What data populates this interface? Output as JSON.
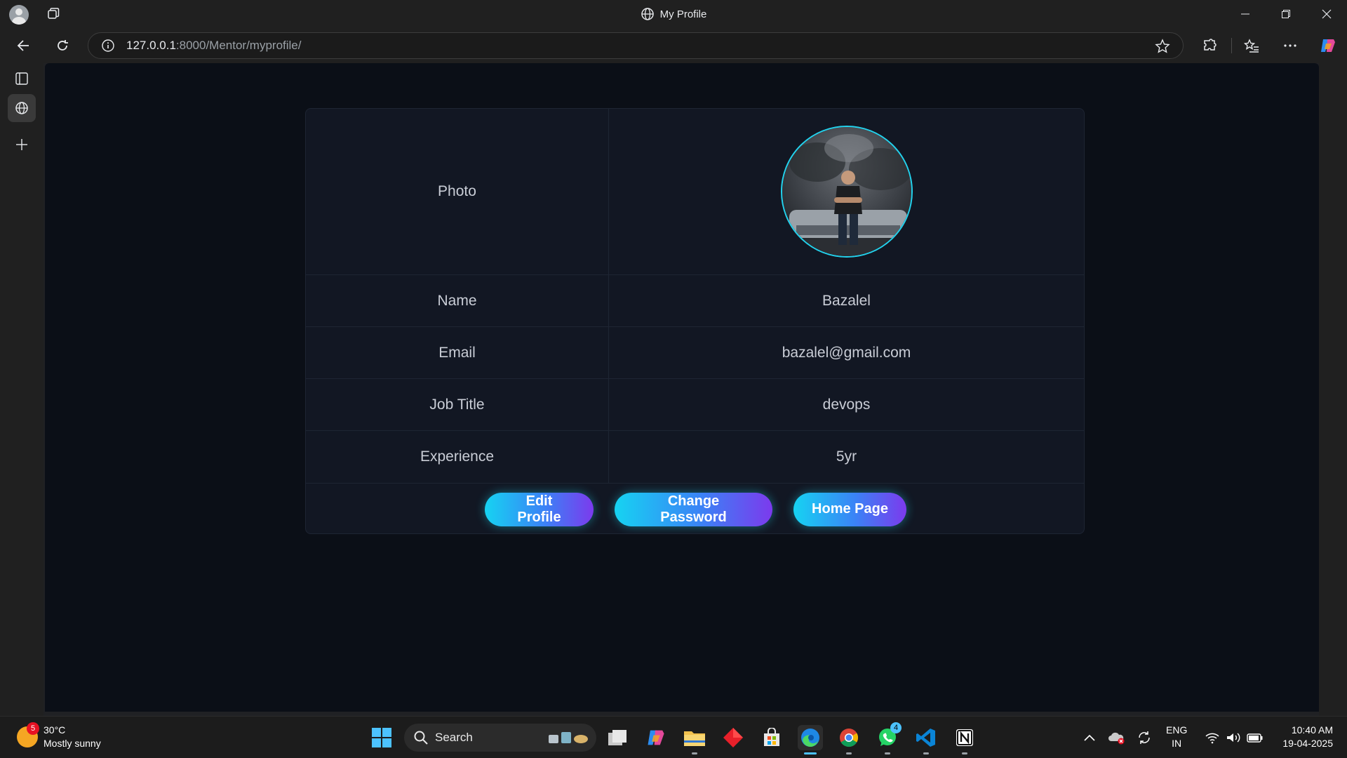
{
  "window": {
    "title": "My Profile"
  },
  "addressbar": {
    "url_host": "127.0.0.1",
    "url_rest": ":8000/Mentor/myprofile/"
  },
  "profile": {
    "rows": [
      {
        "label": "Photo",
        "value": ""
      },
      {
        "label": "Name",
        "value": "Bazalel"
      },
      {
        "label": "Email",
        "value": "bazalel@gmail.com"
      },
      {
        "label": "Job Title",
        "value": "devops"
      },
      {
        "label": "Experience",
        "value": "5yr"
      }
    ],
    "buttons": {
      "edit": "Edit Profile",
      "change_password": "Change Password",
      "home": "Home Page"
    }
  },
  "taskbar": {
    "weather": {
      "temp": "30°C",
      "desc": "Mostly sunny",
      "badge": "5"
    },
    "search_label": "Search",
    "whatsapp_badge": "4",
    "lang": {
      "line1": "ENG",
      "line2": "IN"
    },
    "clock": {
      "time": "10:40 AM",
      "date": "19-04-2025"
    }
  },
  "colors": {
    "accent_cyan": "#22d3ee",
    "button_gradient_start": "#16d3f2",
    "button_gradient_end": "#7c3aed",
    "page_bg": "#0b0f17",
    "card_bg": "#121723"
  }
}
